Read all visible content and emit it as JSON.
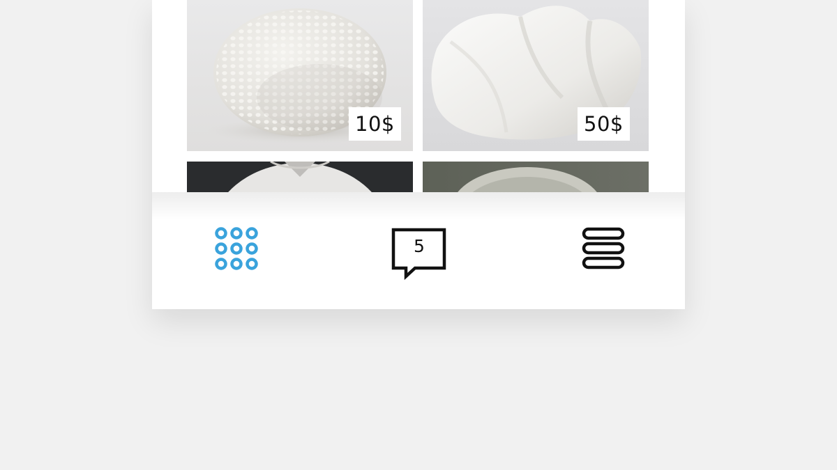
{
  "products": [
    {
      "name": "egg-sculpture",
      "price": "10$"
    },
    {
      "name": "wave-sculpture",
      "price": "50$"
    },
    {
      "name": "ring-sculpture",
      "price": ""
    },
    {
      "name": "bowl-sculpture",
      "price": ""
    }
  ],
  "tabbar": {
    "grid_icon": "grid-dots-icon",
    "messages_icon": "chat-bubble-icon",
    "messages_count": "5",
    "menu_icon": "stack-menu-icon"
  },
  "colors": {
    "accent": "#3aa3dc",
    "icon_dark": "#111111",
    "background": "#f1f1f1",
    "card": "#ffffff"
  }
}
